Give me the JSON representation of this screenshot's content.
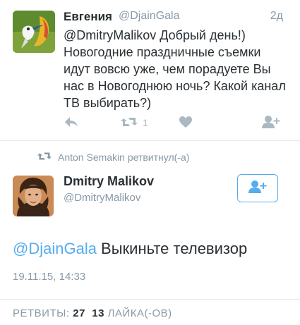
{
  "tweet": {
    "author_name": "Евгения",
    "author_handle": "@DjainGala",
    "time": "2д",
    "body": "@DmitryMalikov Добрый день!) Новогодние праздничные съемки идут вовсю уже, чем порадуете Вы нас в Новогоднюю ночь? Какой канал ТВ выбирать?)",
    "retweet_count": "1"
  },
  "retweet_banner": "Anton Semakin ретвитнул(-а)",
  "main_tweet": {
    "author_name": "Dmitry Malikov",
    "author_handle": "@DmitryMalikov",
    "mention": "@DjainGala",
    "text": " Выкиньте телевизор",
    "date": "19.11.15, 14:33"
  },
  "stats": {
    "retweets_label": "РЕТВИТЫ:",
    "retweets_value": "27",
    "likes_value": "13",
    "likes_label": "ЛАЙКА(-ОВ)"
  },
  "colors": {
    "accent": "#55acee",
    "muted": "#8899a6",
    "icon": "#aab8c2"
  },
  "icons": [
    "reply-icon",
    "retweet-icon",
    "like-icon",
    "follow-icon",
    "retweet-banner-icon"
  ]
}
